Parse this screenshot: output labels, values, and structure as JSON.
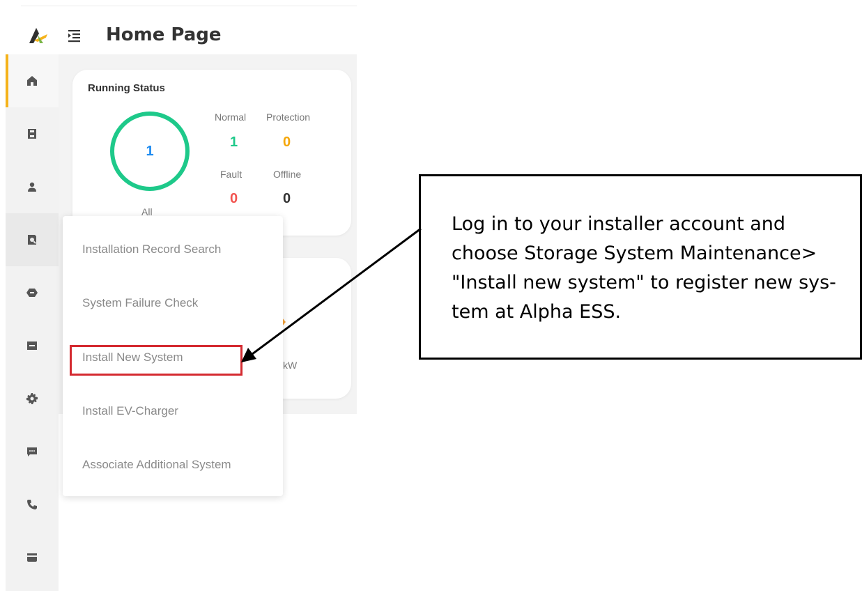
{
  "header": {
    "title": "Home Page"
  },
  "sidebar": {
    "items": [
      {
        "icon": "home-icon",
        "active": true
      },
      {
        "icon": "save-icon"
      },
      {
        "icon": "user-icon"
      },
      {
        "icon": "search-doc-icon",
        "hover": true
      },
      {
        "icon": "hexagon-icon"
      },
      {
        "icon": "inbox-icon"
      },
      {
        "icon": "gear-icon"
      },
      {
        "icon": "chat-icon"
      },
      {
        "icon": "phone-icon"
      },
      {
        "icon": "tray-icon"
      }
    ]
  },
  "running_status": {
    "title": "Running Status",
    "total": "1",
    "total_label": "All",
    "normal_label": "Normal",
    "normal_value": "1",
    "protection_label": "Protection",
    "protection_value": "0",
    "fault_label": "Fault",
    "fault_value": "0",
    "offline_label": "Offline",
    "offline_value": "0"
  },
  "card2": {
    "unit_fragment": "kW"
  },
  "dropdown": {
    "items": [
      "Installation Record Search",
      "System Failure Check",
      "Install New System",
      "Install EV-Charger",
      "Associate Additional System"
    ]
  },
  "callout": {
    "text": "Log in to your installer account and choose Storage System Maintenance> \"Install new system\" to register new sys-tem at Alpha ESS."
  },
  "colors": {
    "accent": "#f5b31b",
    "normal": "#1ec98a",
    "protection": "#f5a70a",
    "fault": "#f25450",
    "total": "#1e8bf0",
    "highlight": "#d42a30"
  }
}
